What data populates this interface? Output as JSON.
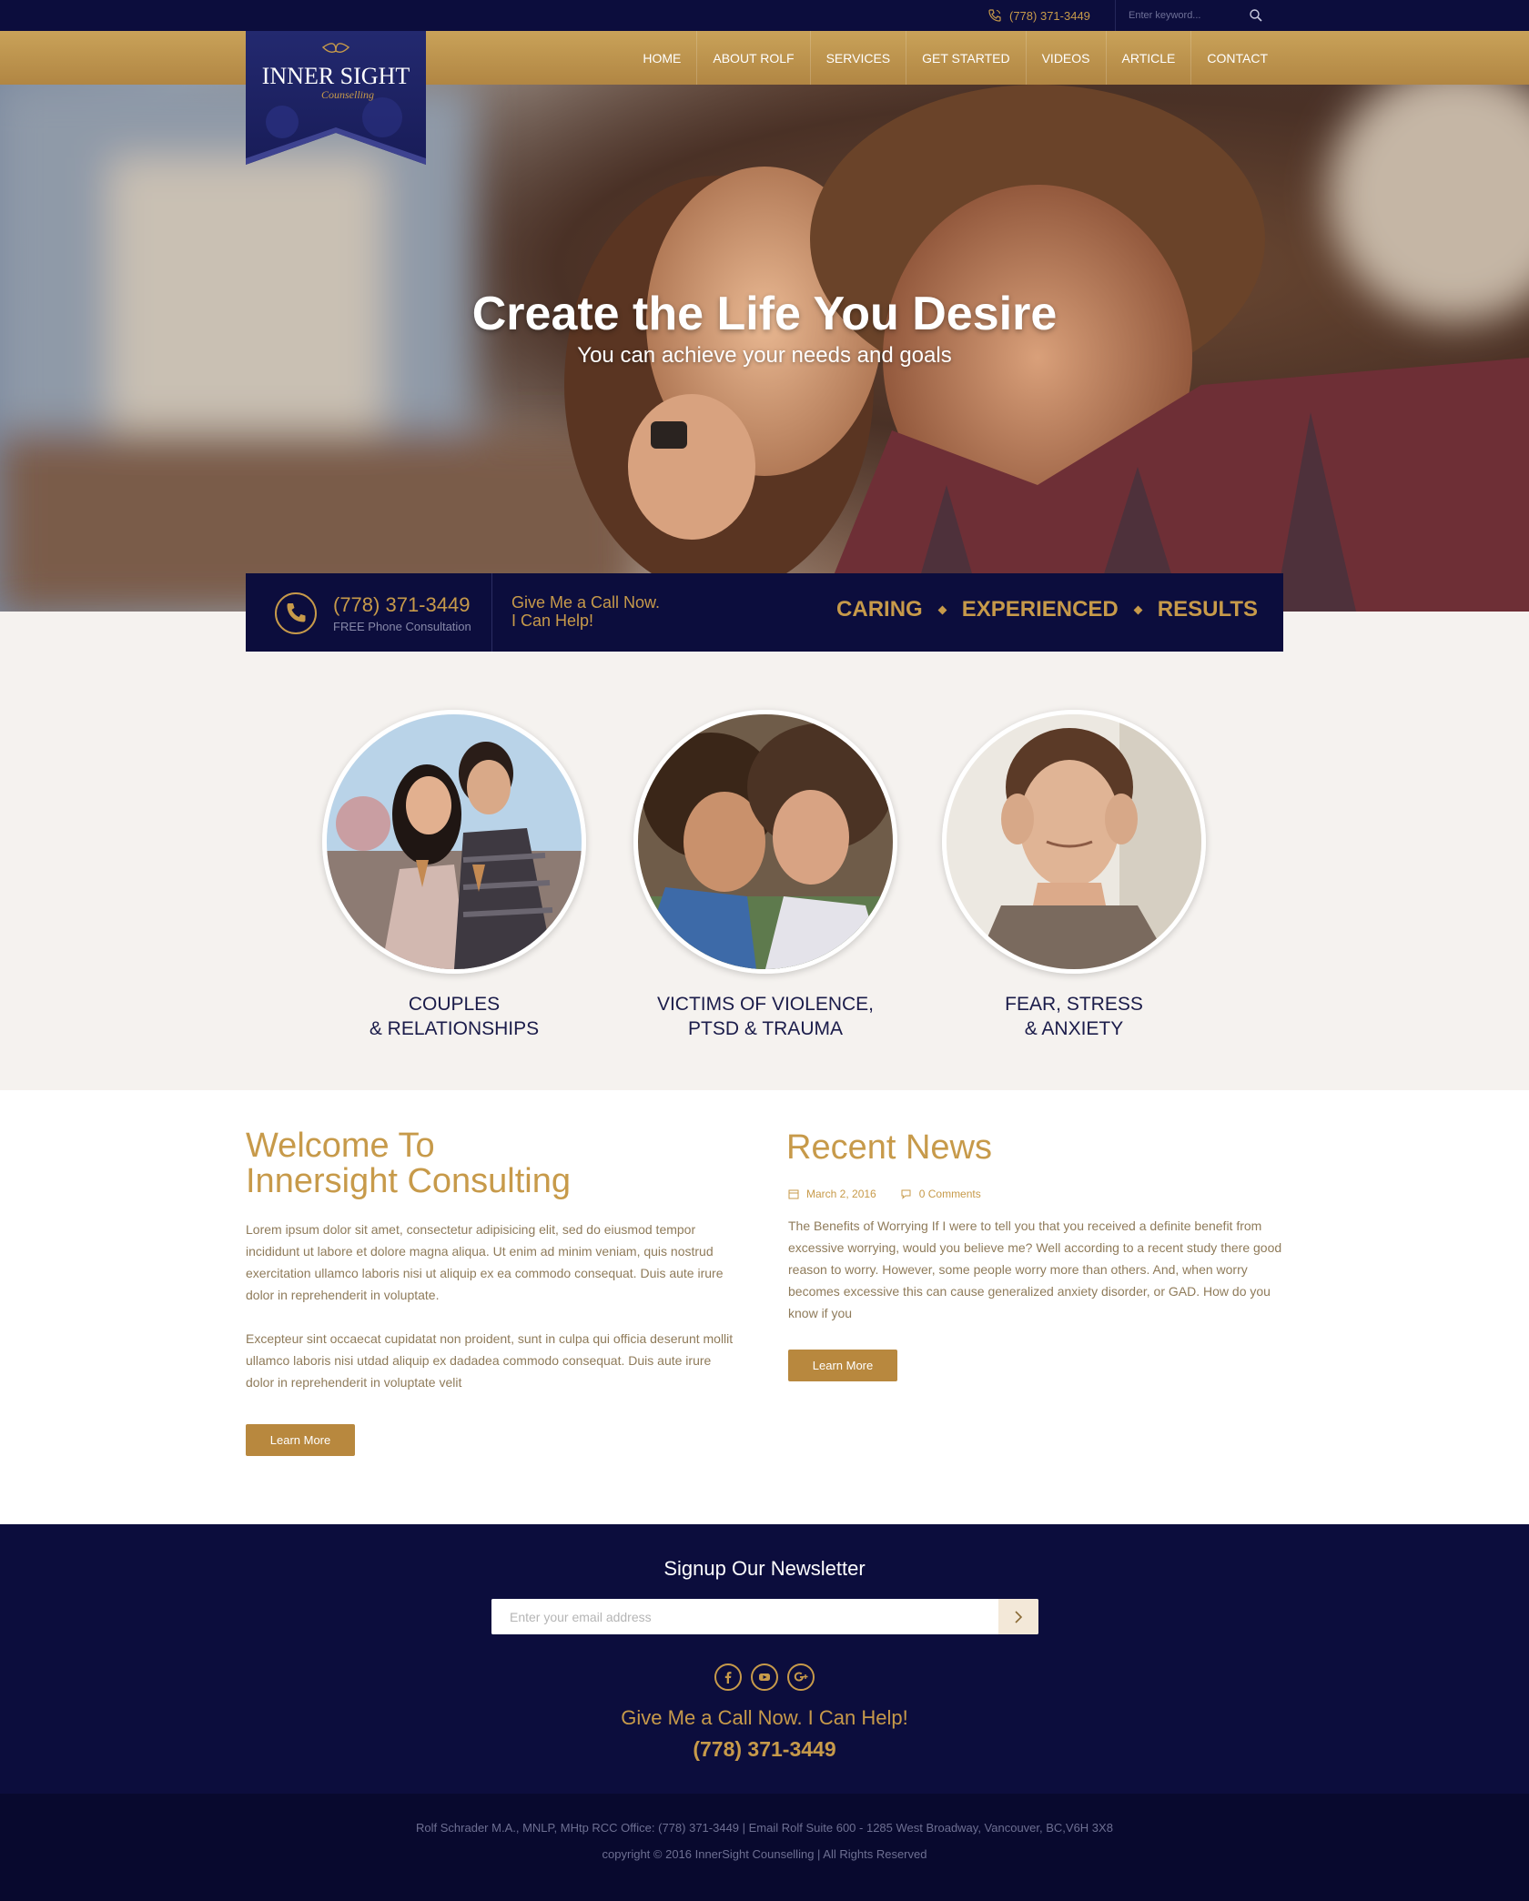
{
  "topbar": {
    "phone": "(778) 371-3449",
    "search_placeholder": "Enter keyword...",
    "search_icon": "search-icon",
    "phone_icon": "phone-icon"
  },
  "logo": {
    "line1": "INNER SIGHT",
    "line2": "Counselling"
  },
  "nav": {
    "items": [
      "HOME",
      "ABOUT ROLF",
      "SERVICES",
      "GET STARTED",
      "VIDEOS",
      "ARTICLE",
      "CONTACT"
    ]
  },
  "hero": {
    "title": "Create the Life You Desire",
    "subtitle": "You can achieve your needs and goals"
  },
  "callbar": {
    "phone": "(778) 371-3449",
    "free_text": "FREE Phone Consultation",
    "give_line1": "Give Me a Call Now.",
    "give_line2": "I Can Help!",
    "tags": [
      "CARING",
      "EXPERIENCED",
      "RESULTS"
    ]
  },
  "services": [
    {
      "line1": "COUPLES",
      "line2": "& RELATIONSHIPS"
    },
    {
      "line1": "VICTIMS OF VIOLENCE,",
      "line2": "PTSD & TRAUMA"
    },
    {
      "line1": "FEAR, STRESS",
      "line2": "& ANXIETY"
    }
  ],
  "welcome": {
    "title_line1": "Welcome To",
    "title_line2": "Innersight Consulting",
    "para1": "Lorem ipsum dolor sit amet, consectetur adipisicing elit, sed do eiusmod tempor incididunt ut labore et dolore magna aliqua. Ut enim ad minim veniam, quis nostrud exercitation ullamco laboris nisi ut aliquip ex ea commodo consequat. Duis aute irure dolor in reprehenderit in voluptate.",
    "para2": "Excepteur sint occaecat cupidatat non proident, sunt in culpa qui officia deserunt mollit ullamco laboris nisi utdad aliquip ex dadadea commodo consequat. Duis aute irure dolor in reprehenderit in voluptate velit",
    "button": "Learn More"
  },
  "news": {
    "title": "Recent News",
    "date": "March 2, 2016",
    "comments": "0 Comments",
    "body": "The Benefits of Worrying If I were to tell you that you received a definite benefit from excessive worrying, would you believe me? Well according to a recent study there good reason to worry. However, some people worry more than others. And, when worry becomes excessive this can cause generalized anxiety disorder, or GAD. How do you know if you",
    "button": "Learn More"
  },
  "footer": {
    "newsletter_title": "Signup Our Newsletter",
    "email_placeholder": "Enter your email address",
    "socials": [
      "facebook-icon",
      "youtube-icon",
      "google-plus-icon"
    ],
    "give": "Give Me a Call Now. I Can Help!",
    "phone": "(778) 371-3449",
    "address": "Rolf Schrader M.A., MNLP, MHtp RCC Office: (778) 371-3449 | Email Rolf Suite 600 - 1285 West Broadway, Vancouver, BC,V6H 3X8",
    "copyright": "copyright © 2016 InnerSight Counselling | All Rights Reserved"
  },
  "colors": {
    "navy": "#0c0d3d",
    "gold": "#c79a4a",
    "nav_gold": "#b8883e",
    "text_brown": "#8f7b5a",
    "section_bg": "#f5f2ef"
  }
}
